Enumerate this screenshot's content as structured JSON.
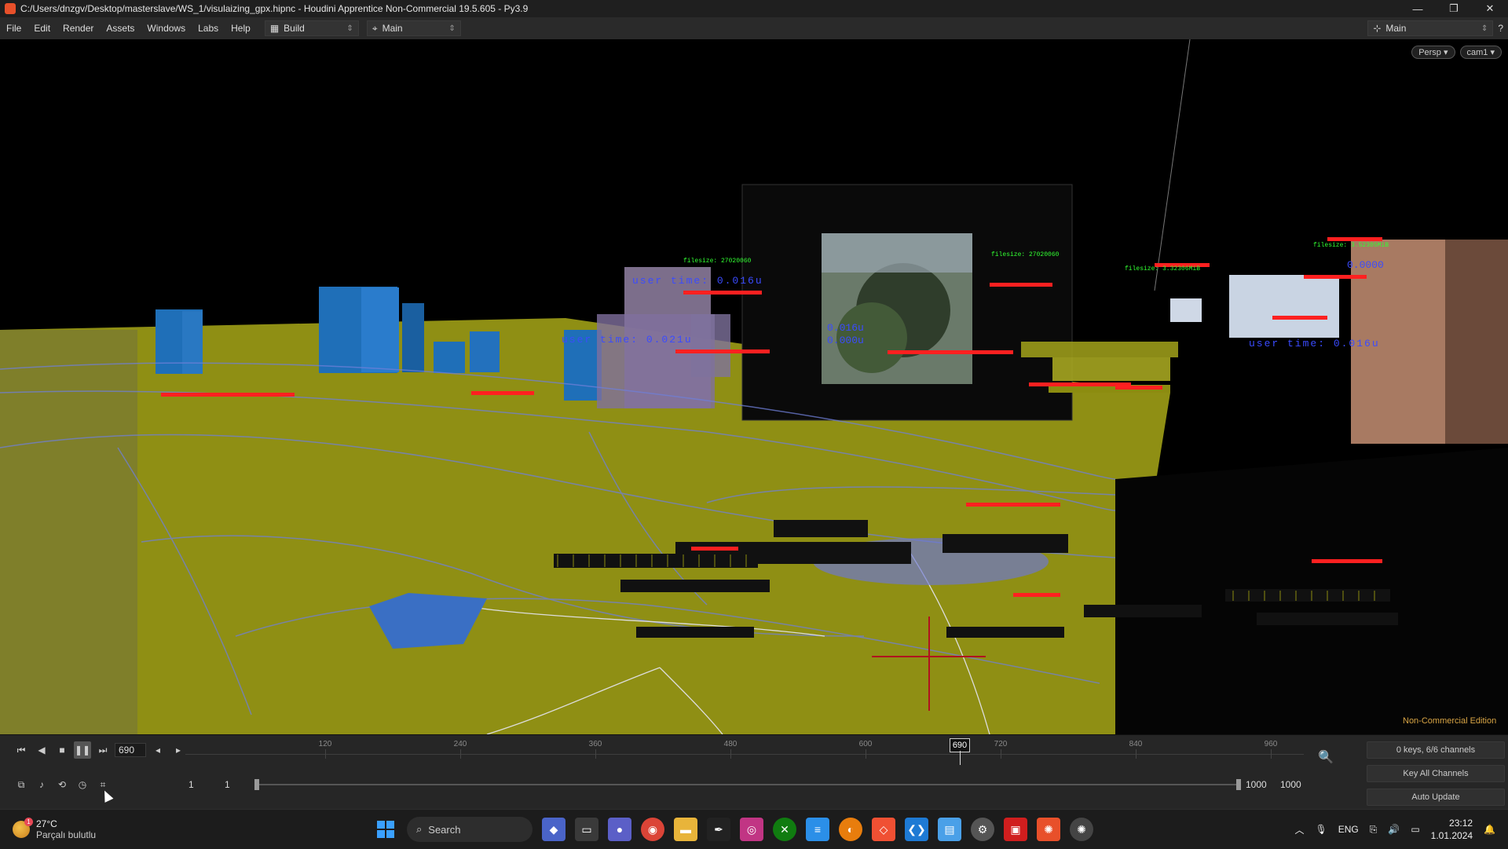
{
  "window": {
    "title": "C:/Users/dnzgv/Desktop/masterslave/WS_1/visulaizing_gpx.hipnc - Houdini Apprentice Non-Commercial 19.5.605 - Py3.9",
    "minimize": "—",
    "maximize": "❐",
    "close": "✕"
  },
  "menubar": {
    "items": [
      "File",
      "Edit",
      "Render",
      "Assets",
      "Windows",
      "Labs",
      "Help"
    ],
    "desktop_select": "Build",
    "network_select": "Main",
    "right_desktop": "Main"
  },
  "viewport": {
    "persp_label": "Persp ▾",
    "cam_label": "cam1 ▾",
    "watermark": "Non-Commercial Edition",
    "overlay_labels": [
      "filesize: 27020060",
      "filesize: 27020060",
      "filesize: 3.32306MiB",
      "filesize: 3.52305MiB",
      "user time: 0.016u",
      "user time: 0.021u",
      "user time: 0.016u",
      "0.016u",
      "0.000u",
      "0.0000"
    ]
  },
  "timeline": {
    "current_frame": "690",
    "ticks": [
      "120",
      "240",
      "360",
      "480",
      "600",
      "720",
      "840",
      "960"
    ],
    "cursor_label": "690",
    "range_start": "1",
    "range_start2": "1",
    "range_end": "1000",
    "range_end2": "1000",
    "keys_info": "0 keys, 6/6 channels",
    "key_all": "Key All Channels",
    "auto_update": "Auto Update"
  },
  "taskbar": {
    "weather_temp": "27°C",
    "weather_desc": "Parçalı bulutlu",
    "weather_badge": "1",
    "search_label": "Search",
    "lang": "ENG",
    "time": "23:12",
    "date": "1.01.2024"
  },
  "colors": {
    "ground": "#8f8f14",
    "building": "#1f6fb8",
    "overlay_green": "#32ff32",
    "overlay_red": "#ff2020",
    "overlay_blue": "#3a4bff"
  }
}
